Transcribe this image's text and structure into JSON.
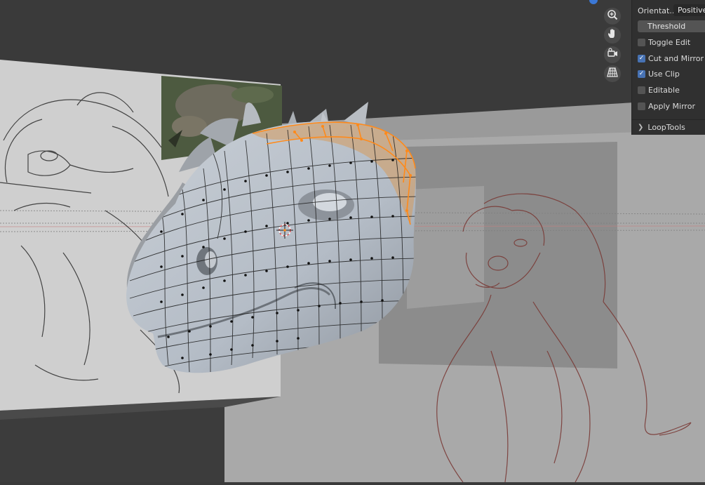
{
  "sidebar": {
    "orientation_label": "Orientat...",
    "orientation_value": "Positive",
    "threshold_label": "Threshold",
    "options": [
      {
        "label": "Toggle Edit",
        "checked": false
      },
      {
        "label": "Cut and Mirror",
        "checked": true
      },
      {
        "label": "Use Clip",
        "checked": true
      },
      {
        "label": "Editable",
        "checked": false
      },
      {
        "label": "Apply Mirror",
        "checked": false
      }
    ],
    "loop_tools_label": "LoopTools"
  },
  "navigation": {
    "icons": [
      "zoom-icon",
      "hand-pan-icon",
      "camera-view-icon",
      "grid-perspective-icon"
    ]
  },
  "colors": {
    "selection_orange": "#ff8a1a",
    "vertex_black": "#111111",
    "checkbox_blue": "#4772b3"
  }
}
